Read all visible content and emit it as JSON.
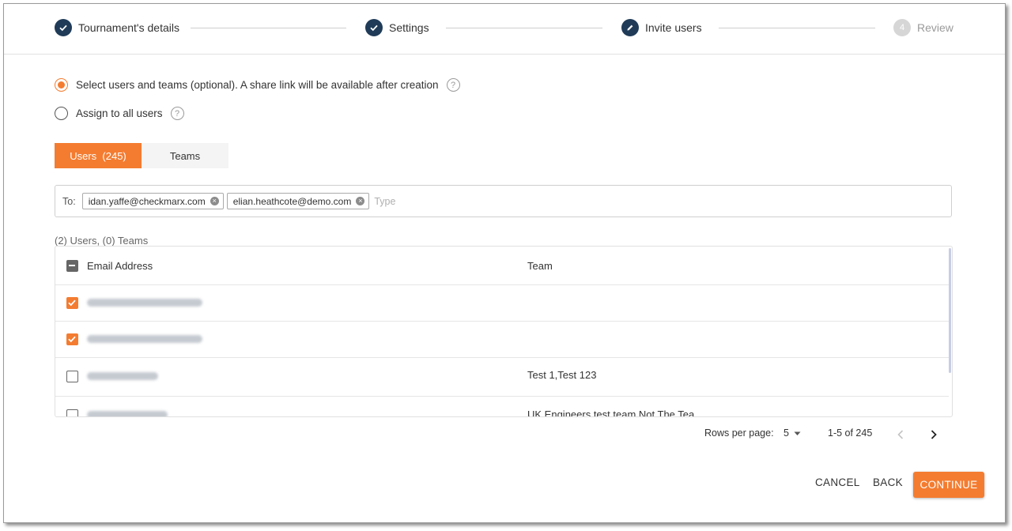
{
  "stepper": {
    "steps": [
      {
        "label": "Tournament's details",
        "state": "done"
      },
      {
        "label": "Settings",
        "state": "done"
      },
      {
        "label": "Invite users",
        "state": "active"
      },
      {
        "label": "Review",
        "state": "pending",
        "number": "4"
      }
    ]
  },
  "assignment": {
    "option_select": "Select users and teams (optional). A share link will be available after creation",
    "option_all": "Assign to all users",
    "help_glyph": "?",
    "selected": "select"
  },
  "tabs": {
    "users": "Users  (245)",
    "teams": "Teams"
  },
  "recipients": {
    "to_label": "To:",
    "chips": [
      "idan.yaffe@checkmarx.com",
      "elian.heathcote@demo.com"
    ],
    "placeholder": "Type"
  },
  "summary": "(2) Users, (0) Teams",
  "table": {
    "header_email": "Email Address",
    "header_team": "Team",
    "rows": [
      {
        "checked": true,
        "team": ""
      },
      {
        "checked": true,
        "team": ""
      },
      {
        "checked": false,
        "team": "Test 1,Test 123"
      },
      {
        "checked": false,
        "team": "UK Engineers test team Not The Tea"
      }
    ]
  },
  "pagination": {
    "rows_label": "Rows per page:",
    "rows_value": "5",
    "range": "1-5 of 245"
  },
  "actions": {
    "cancel": "CANCEL",
    "back": "BACK",
    "continue": "CONTINUE"
  },
  "colors": {
    "accent": "#f47c30",
    "step_done": "#1f3b58"
  }
}
